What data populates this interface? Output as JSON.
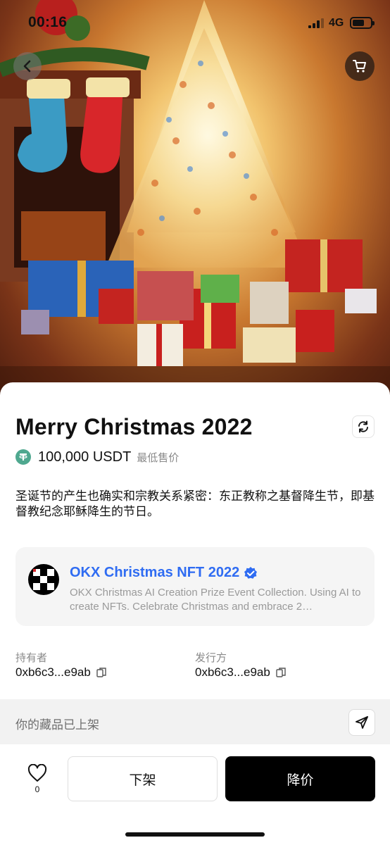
{
  "status_bar": {
    "time": "00:16",
    "network": "4G"
  },
  "nft": {
    "title": "Merry Christmas 2022",
    "price": "100,000 USDT",
    "price_label": "最低售价",
    "description": "圣诞节的产生也确实和宗教关系紧密：东正教称之基督降生节，即基督教纪念耶稣降生的节日。"
  },
  "collection": {
    "name": "OKX Christmas NFT 2022",
    "description": "OKX Christmas AI Creation Prize Event Collection. Using AI to create NFTs. Celebrate Christmas and embrace 2…"
  },
  "meta": {
    "owner_label": "持有者",
    "owner_value": "0xb6c3...e9ab",
    "issuer_label": "发行方",
    "issuer_value": "0xb6c3...e9ab"
  },
  "listing": {
    "status_text": "你的藏品已上架"
  },
  "actions": {
    "like_count": "0",
    "delist_label": "下架",
    "reduce_price_label": "降价"
  },
  "colors": {
    "accent_blue": "#2f6cf2",
    "usdt_green": "#4fa88f",
    "primary_button": "#000000"
  },
  "icons": [
    "back-icon",
    "cart-icon",
    "refresh-icon",
    "usdt-icon",
    "okx-logo-icon",
    "verified-icon",
    "copy-icon",
    "share-icon",
    "heart-icon"
  ]
}
